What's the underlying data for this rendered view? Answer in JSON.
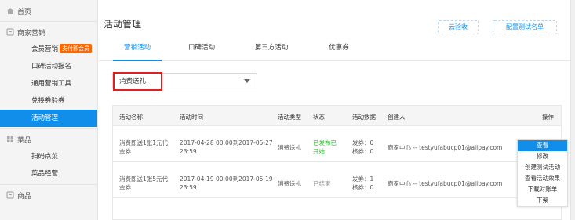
{
  "sidebar": {
    "home": "首页",
    "groups": [
      {
        "label": "商家营销",
        "icon": "store-icon"
      },
      {
        "label": "菜品",
        "icon": "grid-icon"
      },
      {
        "label": "商品",
        "icon": "product-icon"
      }
    ],
    "marketing_items": [
      {
        "label": "会员营销",
        "badge": "支付即会员"
      },
      {
        "label": "口碑活动报名"
      },
      {
        "label": "通用营销工具"
      },
      {
        "label": "兑换券验券"
      },
      {
        "label": "活动管理"
      }
    ],
    "dish_items": [
      {
        "label": "扫码点菜"
      },
      {
        "label": "菜品经营"
      }
    ],
    "active_item": "活动管理"
  },
  "main": {
    "title": "活动管理",
    "verify_button": "云验收",
    "config_button": "配置测试名单",
    "tabs": [
      "营销活动",
      "口碑活动",
      "第三方活动",
      "优惠券"
    ],
    "active_tab": "营销活动",
    "filter_select": "消费送礼"
  },
  "table": {
    "headers": [
      "活动名称",
      "活动时间",
      "活动类型",
      "状态",
      "活动数据",
      "创建人",
      "操作"
    ],
    "rows": [
      {
        "name_line1": "消费即送1张1元代",
        "name_line2": "金券",
        "time_line1": "2017-04-28 00:00到2017-05-27",
        "time_line2": "23:59",
        "type": "消费送礼",
        "status_line1": "已发布已",
        "status_line2": "开始",
        "data_line1": "发券：0",
        "data_line2": "核券：0",
        "creator": "商家中心 -- testyufabucp01@alipay.com"
      },
      {
        "name_line1": "消费即送1张5元代",
        "name_line2": "金券",
        "time_line1": "2017-04-19 00:00到2017-05-19",
        "time_line2": "23:59",
        "type": "消费送礼",
        "status_line1": "已结束",
        "status_line2": "",
        "data_line1": "发券：1",
        "data_line2": "核券：0",
        "creator": "商家中心 -- testyufabucp01@alipay.com"
      }
    ],
    "action_menu": [
      "查看",
      "修改",
      "创建测试活动",
      "查看活动效果",
      "下载对账单",
      "下架"
    ]
  },
  "colors": {
    "primary": "#108ee9",
    "badge": "#ff6600",
    "highlight_border": "#e02020",
    "status_live": "#2eb82e"
  }
}
